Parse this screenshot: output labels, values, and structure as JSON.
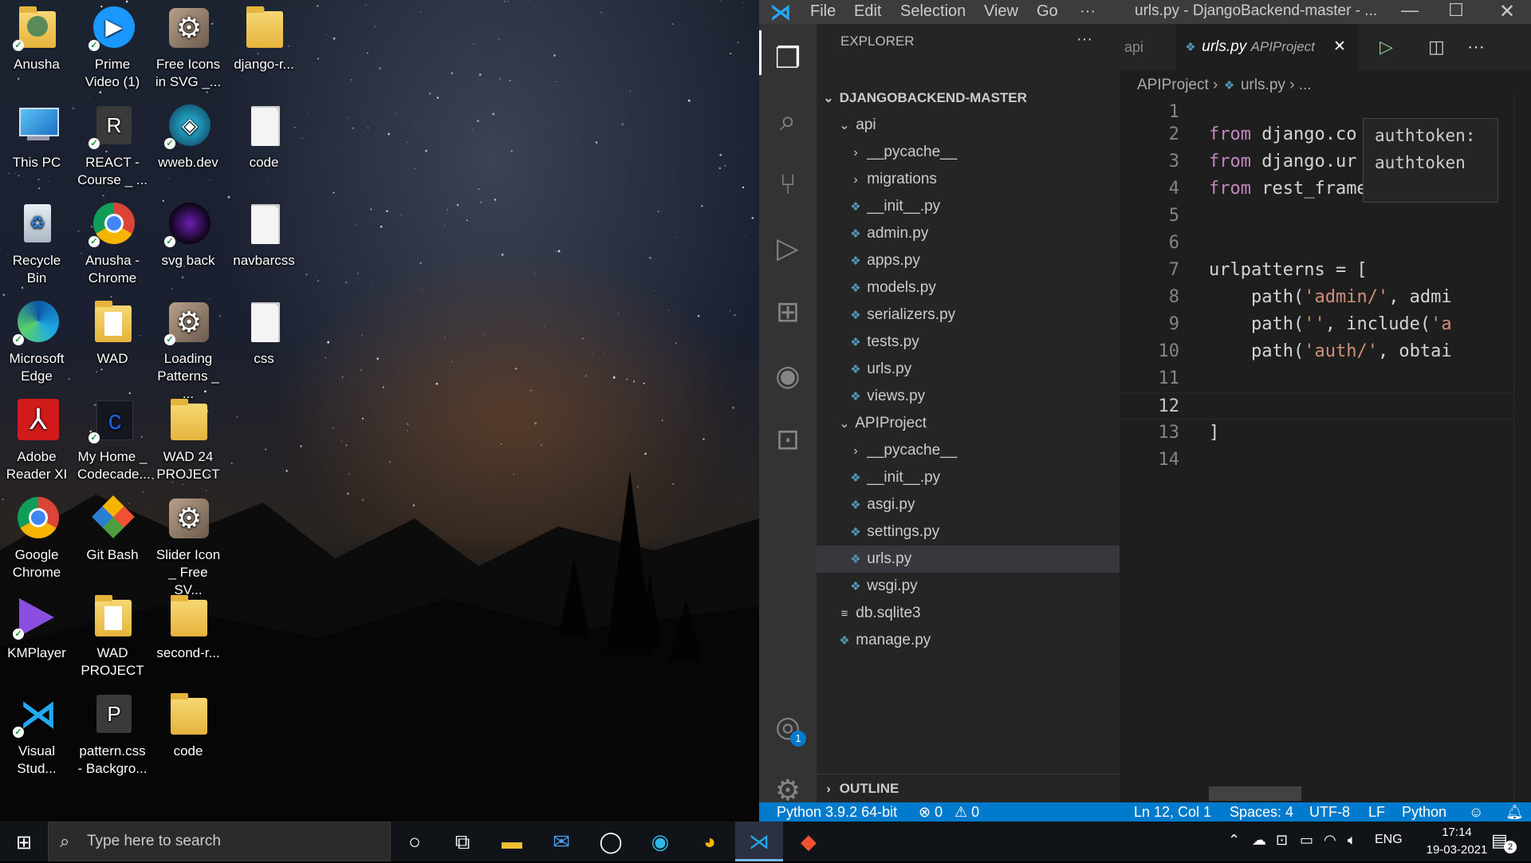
{
  "desktop": {
    "icons": [
      {
        "label": "Anusha"
      },
      {
        "label": "Prime\nVideo (1)"
      },
      {
        "label": "Free Icons\nin SVG _..."
      },
      {
        "label": "django-r..."
      },
      {
        "label": "This PC"
      },
      {
        "label": "REACT -\nCourse _ ..."
      },
      {
        "label": "wweb.dev"
      },
      {
        "label": "code"
      },
      {
        "label": "Recycle Bin"
      },
      {
        "label": "Anusha -\nChrome"
      },
      {
        "label": "svg back"
      },
      {
        "label": "navbarcss"
      },
      {
        "label": "Microsoft\nEdge"
      },
      {
        "label": "WAD"
      },
      {
        "label": "Loading\nPatterns _ ..."
      },
      {
        "label": "css"
      },
      {
        "label": "Adobe\nReader XI"
      },
      {
        "label": "My Home _\nCodecade..."
      },
      {
        "label": "WAD 24\nPROJECT"
      },
      {
        "label": "Google\nChrome"
      },
      {
        "label": "Git Bash"
      },
      {
        "label": "Slider Icon\n_ Free SV..."
      },
      {
        "label": "KMPlayer"
      },
      {
        "label": "WAD\nPROJECT"
      },
      {
        "label": "second-r..."
      },
      {
        "label": "Visual\nStud..."
      },
      {
        "label": "pattern.css\n- Backgro..."
      },
      {
        "label": "code"
      }
    ],
    "react_letter": "R",
    "pattern_letter": "P"
  },
  "vscode": {
    "menu": [
      "File",
      "Edit",
      "Selection",
      "View",
      "Go",
      "···"
    ],
    "window_title": "urls.py - DjangoBackend-master - ...",
    "explorer": {
      "title": "EXPLORER",
      "more": "···",
      "root": "DJANGOBACKEND-MASTER",
      "items": [
        {
          "label": "api"
        },
        {
          "label": "__pycache__"
        },
        {
          "label": "migrations"
        },
        {
          "label": "__init__.py"
        },
        {
          "label": "admin.py"
        },
        {
          "label": "apps.py"
        },
        {
          "label": "models.py"
        },
        {
          "label": "serializers.py"
        },
        {
          "label": "tests.py"
        },
        {
          "label": "urls.py"
        },
        {
          "label": "views.py"
        },
        {
          "label": "APIProject"
        },
        {
          "label": "__pycache__"
        },
        {
          "label": "__init__.py"
        },
        {
          "label": "asgi.py"
        },
        {
          "label": "settings.py"
        },
        {
          "label": "urls.py"
        },
        {
          "label": "wsgi.py"
        },
        {
          "label": "db.sqlite3"
        },
        {
          "label": "manage.py"
        }
      ],
      "outline": "OUTLINE"
    },
    "tabs": {
      "prev": "api",
      "active_file": "urls.py",
      "active_folder": "APIProject"
    },
    "breadcrumb": {
      "folder": "APIProject",
      "file": "urls.py",
      "more": "..."
    },
    "code": {
      "line_numbers": [
        "1",
        "2",
        "3",
        "4",
        "5",
        "6",
        "7",
        "8",
        "9",
        "10",
        "11",
        "12",
        "13",
        "14"
      ],
      "l2_kw": "from",
      "l2_rest": " django.co",
      "l3_kw": "from",
      "l3_rest": " django.ur",
      "l4_kw": "from",
      "l4_rest": " rest_framework.aut",
      "l7": "urlpatterns = [",
      "l8_a": "    path(",
      "l8_s": "'admin/'",
      "l8_b": ", admi",
      "l9_a": "    path(",
      "l9_s": "''",
      "l9_b": ", include(",
      "l9_s2": "'a",
      "l10_a": "    path(",
      "l10_s": "'auth/'",
      "l10_b": ", obtai",
      "l13": "]"
    },
    "hover": {
      "line1": "authtoken:",
      "line2": "authtoken"
    },
    "account_badge": "1",
    "status": {
      "python": "Python 3.9.2 64-bit",
      "errors": "⊗ 0",
      "warnings": "⚠ 0",
      "position": "Ln 12, Col 1",
      "spaces": "Spaces: 4",
      "encoding": "UTF-8",
      "eol": "LF",
      "language": "Python"
    }
  },
  "taskbar": {
    "search_placeholder": "Type here to search",
    "language": "ENG",
    "time": "17:14",
    "date": "19-03-2021",
    "notifications": "2"
  },
  "colors": {
    "accent": "#007acc",
    "python_icon": "#519aba",
    "keyword": "#c586c0",
    "string": "#ce9178"
  }
}
